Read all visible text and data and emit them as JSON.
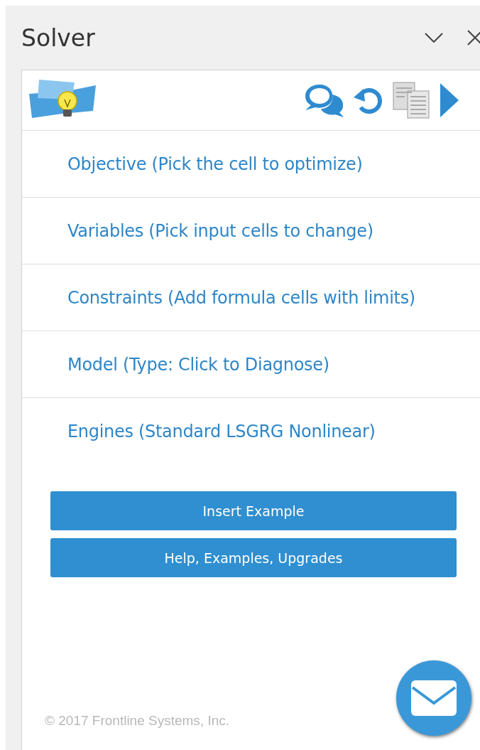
{
  "pane": {
    "title": "Solver"
  },
  "sections": [
    {
      "label": "Objective (Pick the cell to optimize)"
    },
    {
      "label": "Variables (Pick input cells to change)"
    },
    {
      "label": "Constraints (Add formula cells with limits)"
    },
    {
      "label": "Model (Type: Click to Diagnose)"
    },
    {
      "label": "Engines (Standard LSGRG Nonlinear)"
    }
  ],
  "buttons": [
    "Insert Example",
    "Help, Examples, Upgrades"
  ],
  "footer": "© 2017 Frontline Systems, Inc."
}
